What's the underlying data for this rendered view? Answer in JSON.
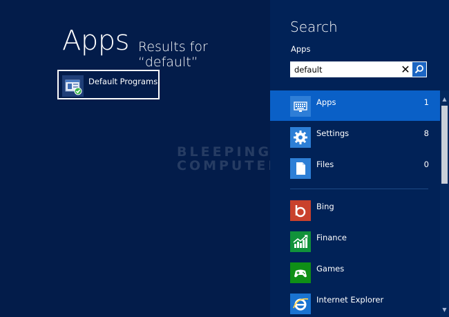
{
  "screen": {
    "heading": "Apps",
    "results_for": "Results for “default”",
    "watermark_line1": "BLEEPING",
    "watermark_line2": "COMPUTER",
    "results": [
      {
        "label": "Default Programs",
        "icon": "default-programs-icon"
      }
    ]
  },
  "charm": {
    "title": "Search",
    "scope": "Apps",
    "search": {
      "value": "default",
      "placeholder": ""
    },
    "scopes": [
      {
        "label": "Apps",
        "count": "1",
        "icon": "keyboard-icon",
        "color": "#2e7ed7",
        "selected": true
      },
      {
        "label": "Settings",
        "count": "8",
        "icon": "gear-icon",
        "color": "#2d7fd6"
      },
      {
        "label": "Files",
        "count": "0",
        "icon": "document-icon",
        "color": "#2d7fd6"
      }
    ],
    "apps": [
      {
        "label": "Bing",
        "icon": "bing-icon",
        "color": "#c9412c"
      },
      {
        "label": "Finance",
        "icon": "finance-chart-icon",
        "color": "#11923a"
      },
      {
        "label": "Games",
        "icon": "gamepad-icon",
        "color": "#0f8f16"
      },
      {
        "label": "Internet Explorer",
        "icon": "internet-explorer-icon",
        "color": "#1a73d1"
      }
    ]
  },
  "colors": {
    "background": "#031c4a",
    "charm_background": "#012257",
    "selection": "#0a60c7",
    "search_button": "#1c65c3"
  }
}
